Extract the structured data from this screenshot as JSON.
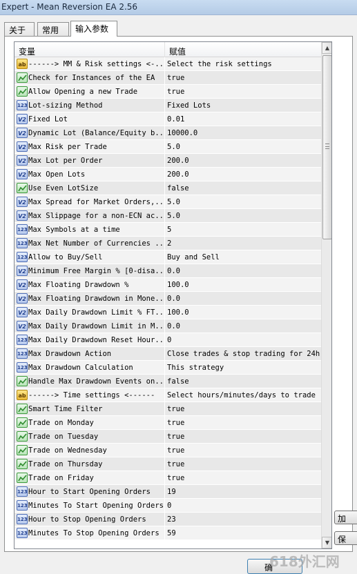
{
  "window": {
    "title": "Expert - Mean Reversion EA 2.56"
  },
  "tabs": [
    {
      "label": "关于"
    },
    {
      "label": "常用"
    },
    {
      "label": "输入参数"
    }
  ],
  "active_tab_index": 2,
  "table": {
    "headers": {
      "variable": "变量",
      "value": "赋值"
    },
    "rows": [
      {
        "type": "string",
        "name": "------> MM & Risk settings <-...",
        "value": "Select the risk settings"
      },
      {
        "type": "bool",
        "name": "Check for Instances of the EA",
        "value": "true"
      },
      {
        "type": "bool",
        "name": "Allow Opening a new Trade",
        "value": "true"
      },
      {
        "type": "int",
        "name": "Lot-sizing Method",
        "value": "Fixed Lots"
      },
      {
        "type": "double",
        "name": "Fixed Lot",
        "value": "0.01"
      },
      {
        "type": "double",
        "name": "Dynamic Lot (Balance/Equity b...",
        "value": "10000.0"
      },
      {
        "type": "double",
        "name": "Max Risk per Trade",
        "value": "5.0"
      },
      {
        "type": "double",
        "name": "Max Lot per Order",
        "value": "200.0"
      },
      {
        "type": "double",
        "name": "Max Open Lots",
        "value": "200.0"
      },
      {
        "type": "bool",
        "name": "Use Even LotSize",
        "value": "false"
      },
      {
        "type": "double",
        "name": "Max Spread for Market Orders,...",
        "value": "5.0"
      },
      {
        "type": "double",
        "name": "Max Slippage for a non-ECN ac...",
        "value": "5.0"
      },
      {
        "type": "int",
        "name": "Max Symbols at a time",
        "value": "5"
      },
      {
        "type": "int",
        "name": "Max Net Number of Currencies ...",
        "value": "2"
      },
      {
        "type": "int",
        "name": "Allow to Buy/Sell",
        "value": "Buy and Sell"
      },
      {
        "type": "double",
        "name": "Minimum Free Margin % [0-disa...",
        "value": "0.0"
      },
      {
        "type": "double",
        "name": "Max Floating Drawdown %",
        "value": "100.0"
      },
      {
        "type": "double",
        "name": "Max Floating Drawdown in Mone...",
        "value": "0.0"
      },
      {
        "type": "double",
        "name": "Max Daily Drawdown Limit % FT...",
        "value": "100.0"
      },
      {
        "type": "double",
        "name": "Max Daily Drawdown Limit in M...",
        "value": "0.0"
      },
      {
        "type": "int",
        "name": "Max Daily Drawdown Reset Hour...",
        "value": "0"
      },
      {
        "type": "int",
        "name": "Max Drawdown Action",
        "value": "Close trades & stop trading for 24h"
      },
      {
        "type": "int",
        "name": "Max Drawdown Calculation",
        "value": "This strategy"
      },
      {
        "type": "bool",
        "name": "Handle Max Drawdown Events on...",
        "value": "false"
      },
      {
        "type": "string",
        "name": "------> Time settings <------",
        "value": "Select hours/minutes/days to trade"
      },
      {
        "type": "bool",
        "name": "Smart Time Filter",
        "value": "true"
      },
      {
        "type": "bool",
        "name": "Trade on Monday",
        "value": "true"
      },
      {
        "type": "bool",
        "name": "Trade on Tuesday",
        "value": "true"
      },
      {
        "type": "bool",
        "name": "Trade on Wednesday",
        "value": "true"
      },
      {
        "type": "bool",
        "name": "Trade on Thursday",
        "value": "true"
      },
      {
        "type": "bool",
        "name": "Trade on Friday",
        "value": "true"
      },
      {
        "type": "int",
        "name": "Hour to Start Opening Orders",
        "value": "19"
      },
      {
        "type": "int",
        "name": "Minutes To Start Opening Orders",
        "value": "0"
      },
      {
        "type": "int",
        "name": "Hour to Stop Opening Orders",
        "value": "23"
      },
      {
        "type": "int",
        "name": "Minutes To Stop Opening Orders",
        "value": "59"
      }
    ]
  },
  "type_icons": {
    "string": "ab",
    "bool": "",
    "int": "123",
    "double": "V2"
  },
  "side_buttons": [
    {
      "label": "加"
    },
    {
      "label": "保"
    }
  ],
  "bottom_button": {
    "label": "确"
  },
  "watermark": "618外汇网",
  "colors": {
    "title_bar": "#c0d5ed",
    "row_even": "#f3f3f3",
    "row_odd": "#e8e8e8",
    "bool_icon": "#2e8b2e"
  }
}
